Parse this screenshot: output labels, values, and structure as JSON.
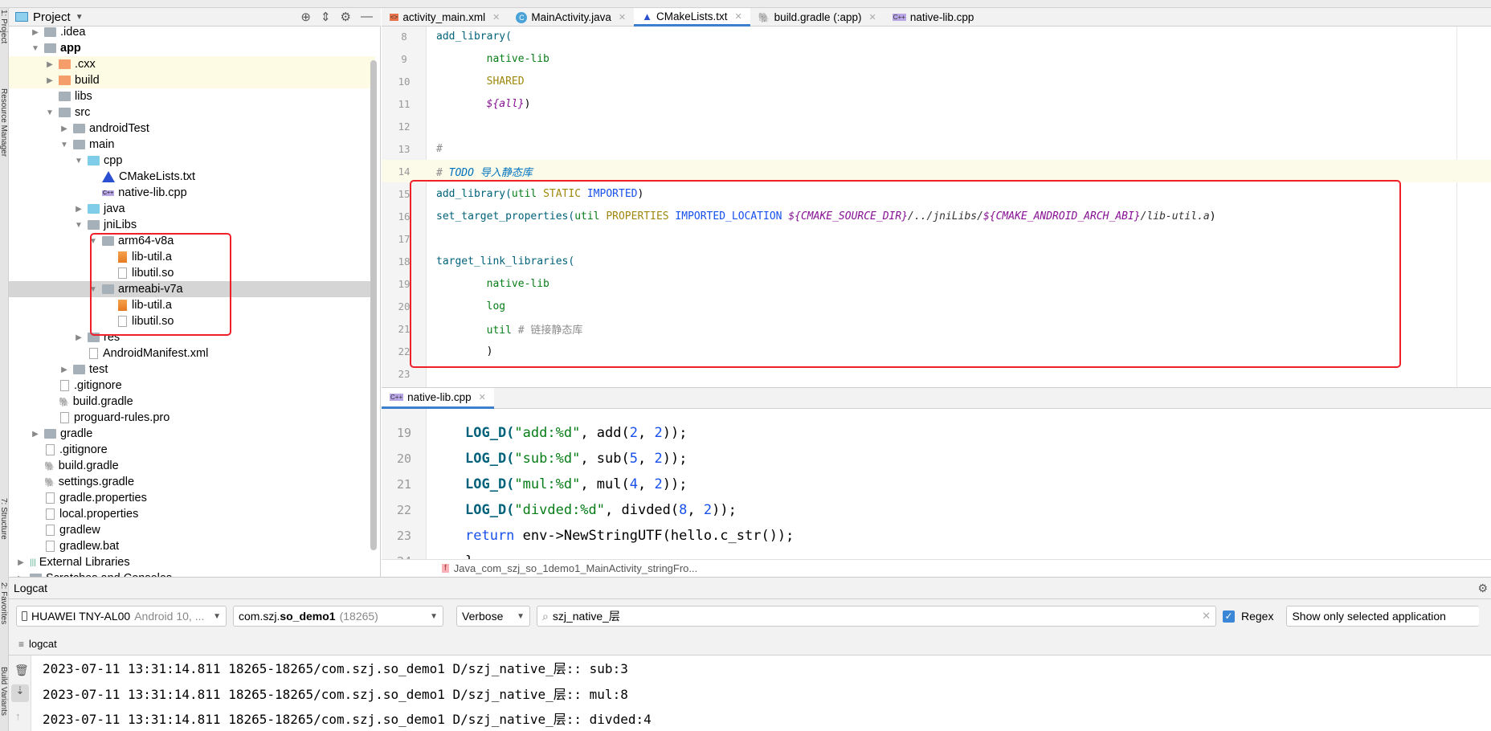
{
  "side_tabs": {
    "project": "1: Project",
    "resource_manager": "Resource Manager",
    "structure": "7: Structure",
    "favorites": "2: Favorites",
    "build_variants": "Build Variants"
  },
  "project_panel": {
    "title": "Project",
    "icons": [
      "locate-icon",
      "collapse-icon",
      "gear-icon",
      "minimize-icon"
    ]
  },
  "tree": [
    {
      "label": ".idea",
      "depth": 1,
      "arrow": "▶",
      "icon": "grey"
    },
    {
      "label": "app",
      "depth": 1,
      "arrow": "▼",
      "icon": "grey",
      "bold": true
    },
    {
      "label": ".cxx",
      "depth": 2,
      "arrow": "▶",
      "icon": "orange",
      "hl": true
    },
    {
      "label": "build",
      "depth": 2,
      "arrow": "▶",
      "icon": "orange",
      "hl": true
    },
    {
      "label": "libs",
      "depth": 2,
      "arrow": "",
      "icon": "grey"
    },
    {
      "label": "src",
      "depth": 2,
      "arrow": "▼",
      "icon": "grey"
    },
    {
      "label": "androidTest",
      "depth": 3,
      "arrow": "▶",
      "icon": "grey"
    },
    {
      "label": "main",
      "depth": 3,
      "arrow": "▼",
      "icon": "grey"
    },
    {
      "label": "cpp",
      "depth": 4,
      "arrow": "▼",
      "icon": "blue"
    },
    {
      "label": "CMakeLists.txt",
      "depth": 5,
      "arrow": "",
      "icon": "cmake"
    },
    {
      "label": "native-lib.cpp",
      "depth": 5,
      "arrow": "",
      "icon": "cpp"
    },
    {
      "label": "java",
      "depth": 4,
      "arrow": "▶",
      "icon": "blue"
    },
    {
      "label": "jniLibs",
      "depth": 4,
      "arrow": "▼",
      "icon": "grey"
    },
    {
      "label": "arm64-v8a",
      "depth": 5,
      "arrow": "▼",
      "icon": "grey"
    },
    {
      "label": "lib-util.a",
      "depth": 6,
      "arrow": "",
      "icon": "lib"
    },
    {
      "label": "libutil.so",
      "depth": 6,
      "arrow": "",
      "icon": "file"
    },
    {
      "label": "armeabi-v7a",
      "depth": 5,
      "arrow": "▼",
      "icon": "grey",
      "sel": true
    },
    {
      "label": "lib-util.a",
      "depth": 6,
      "arrow": "",
      "icon": "lib"
    },
    {
      "label": "libutil.so",
      "depth": 6,
      "arrow": "",
      "icon": "file"
    },
    {
      "label": "res",
      "depth": 4,
      "arrow": "▶",
      "icon": "grey"
    },
    {
      "label": "AndroidManifest.xml",
      "depth": 4,
      "arrow": "",
      "icon": "file"
    },
    {
      "label": "test",
      "depth": 3,
      "arrow": "▶",
      "icon": "grey"
    },
    {
      "label": ".gitignore",
      "depth": 2,
      "arrow": "",
      "icon": "file"
    },
    {
      "label": "build.gradle",
      "depth": 2,
      "arrow": "",
      "icon": "gradle"
    },
    {
      "label": "proguard-rules.pro",
      "depth": 2,
      "arrow": "",
      "icon": "file"
    },
    {
      "label": "gradle",
      "depth": 1,
      "arrow": "▶",
      "icon": "grey"
    },
    {
      "label": ".gitignore",
      "depth": 1,
      "arrow": "",
      "icon": "file"
    },
    {
      "label": "build.gradle",
      "depth": 1,
      "arrow": "",
      "icon": "gradle"
    },
    {
      "label": "settings.gradle",
      "depth": 1,
      "arrow": "",
      "icon": "gradle"
    },
    {
      "label": "gradle.properties",
      "depth": 1,
      "arrow": "",
      "icon": "file"
    },
    {
      "label": "local.properties",
      "depth": 1,
      "arrow": "",
      "icon": "file"
    },
    {
      "label": "gradlew",
      "depth": 1,
      "arrow": "",
      "icon": "file"
    },
    {
      "label": "gradlew.bat",
      "depth": 1,
      "arrow": "",
      "icon": "file"
    },
    {
      "label": "External Libraries",
      "depth": 0,
      "arrow": "▶",
      "icon": "libs"
    },
    {
      "label": "Scratches and Consoles",
      "depth": 0,
      "arrow": "▶",
      "icon": "grey"
    }
  ],
  "editor_tabs": [
    {
      "label": "activity_main.xml",
      "icon": "xml-file-icon",
      "active": false
    },
    {
      "label": "MainActivity.java",
      "icon": "java-class-icon",
      "active": false
    },
    {
      "label": "CMakeLists.txt",
      "icon": "cmake-icon",
      "active": true
    },
    {
      "label": "build.gradle (:app)",
      "icon": "gradle-icon",
      "active": false
    },
    {
      "label": "native-lib.cpp",
      "icon": "cpp-file-icon",
      "active": false
    }
  ],
  "cmake_lines": [
    {
      "n": "8",
      "parts": [
        [
          "fn",
          "add_library("
        ]
      ]
    },
    {
      "n": "9",
      "parts": [
        [
          "str",
          "        native-lib"
        ]
      ]
    },
    {
      "n": "10",
      "parts": [
        [
          "kw",
          "        SHARED"
        ]
      ]
    },
    {
      "n": "11",
      "parts": [
        [
          "var",
          "        ${all}"
        ],
        [
          "",
          ")"
        ]
      ]
    },
    {
      "n": "12",
      "parts": []
    },
    {
      "n": "13",
      "parts": [
        [
          "cm",
          "#"
        ]
      ]
    },
    {
      "n": "14",
      "parts": [
        [
          "cm",
          "# "
        ],
        [
          "todo",
          "TODO 导入静态库"
        ]
      ],
      "current": true
    },
    {
      "n": "15",
      "parts": [
        [
          "fn",
          "add_library("
        ],
        [
          "str",
          "util "
        ],
        [
          "kw",
          "STATIC "
        ],
        [
          "kw2",
          "IMPORTED"
        ],
        [
          "",
          ")"
        ]
      ]
    },
    {
      "n": "16",
      "parts": [
        [
          "fn",
          "set_target_properties("
        ],
        [
          "str",
          "util "
        ],
        [
          "kw",
          "PROPERTIES "
        ],
        [
          "kw2",
          "IMPORTED_LOCATION "
        ],
        [
          "var",
          "${CMAKE_SOURCE_DIR}"
        ],
        [
          "path",
          "/../jniLibs/"
        ],
        [
          "var",
          "${CMAKE_ANDROID_ARCH_ABI}"
        ],
        [
          "path",
          "/lib-util.a"
        ],
        [
          "",
          ")"
        ]
      ]
    },
    {
      "n": "17",
      "parts": []
    },
    {
      "n": "18",
      "parts": [
        [
          "fn",
          "target_link_libraries("
        ]
      ]
    },
    {
      "n": "19",
      "parts": [
        [
          "str",
          "        native-lib"
        ]
      ]
    },
    {
      "n": "20",
      "parts": [
        [
          "str",
          "        log"
        ]
      ]
    },
    {
      "n": "21",
      "parts": [
        [
          "str",
          "        util "
        ],
        [
          "cm",
          "# 链接静态库"
        ]
      ]
    },
    {
      "n": "22",
      "parts": [
        [
          "",
          "        )"
        ]
      ]
    },
    {
      "n": "23",
      "parts": []
    }
  ],
  "split_tab": {
    "label": "native-lib.cpp",
    "icon": "cpp-file-icon"
  },
  "cpp_lines": [
    {
      "n": "19",
      "parts": [
        [
          "fnb",
          "LOG_D("
        ],
        [
          "str",
          "\"add:%d\""
        ],
        [
          "",
          ", add("
        ],
        [
          "num",
          "2"
        ],
        [
          "",
          ", "
        ],
        [
          "num",
          "2"
        ],
        [
          "",
          "));"
        ]
      ]
    },
    {
      "n": "20",
      "parts": [
        [
          "fnb",
          "LOG_D("
        ],
        [
          "str",
          "\"sub:%d\""
        ],
        [
          "",
          ", sub("
        ],
        [
          "num",
          "5"
        ],
        [
          "",
          ", "
        ],
        [
          "num",
          "2"
        ],
        [
          "",
          "));"
        ]
      ]
    },
    {
      "n": "21",
      "parts": [
        [
          "fnb",
          "LOG_D("
        ],
        [
          "str",
          "\"mul:%d\""
        ],
        [
          "",
          ", mul("
        ],
        [
          "num",
          "4"
        ],
        [
          "",
          ", "
        ],
        [
          "num",
          "2"
        ],
        [
          "",
          "));"
        ]
      ]
    },
    {
      "n": "22",
      "parts": [
        [
          "fnb",
          "LOG_D("
        ],
        [
          "str",
          "\"divded:%d\""
        ],
        [
          "",
          ", divded("
        ],
        [
          "num",
          "8"
        ],
        [
          "",
          ", "
        ],
        [
          "num",
          "2"
        ],
        [
          "",
          "));"
        ]
      ]
    },
    {
      "n": "23",
      "parts": [
        [
          "kw2",
          "return "
        ],
        [
          "",
          "env->NewStringUTF(hello.c_str());"
        ]
      ]
    },
    {
      "n": "24",
      "parts": [
        [
          "",
          "}"
        ]
      ]
    }
  ],
  "breadcrumb": {
    "icon": "function-icon",
    "label": "Java_com_szj_so_1demo1_MainActivity_stringFro..."
  },
  "logcat": {
    "title": "Logcat",
    "device": "HUAWEI TNY-AL00",
    "device_os": "Android 10, ...",
    "process_pkg": "com.szj.",
    "process_bold": "so_demo1",
    "process_pid": "(18265)",
    "level": "Verbose",
    "search_value": "szj_native_层",
    "regex_label": "Regex",
    "regex_checked": true,
    "filter": "Show only selected application",
    "tab": "logcat",
    "lines": [
      "2023-07-11 13:31:14.811 18265-18265/com.szj.so_demo1 D/szj_native_层:: sub:3",
      "2023-07-11 13:31:14.811 18265-18265/com.szj.so_demo1 D/szj_native_层:: mul:8",
      "2023-07-11 13:31:14.811 18265-18265/com.szj.so_demo1 D/szj_native_层:: divded:4"
    ]
  },
  "colors": {
    "highlight_box": "#f0202a",
    "active_tab": "#3d7fcf",
    "selection": "#d5d5d5"
  }
}
